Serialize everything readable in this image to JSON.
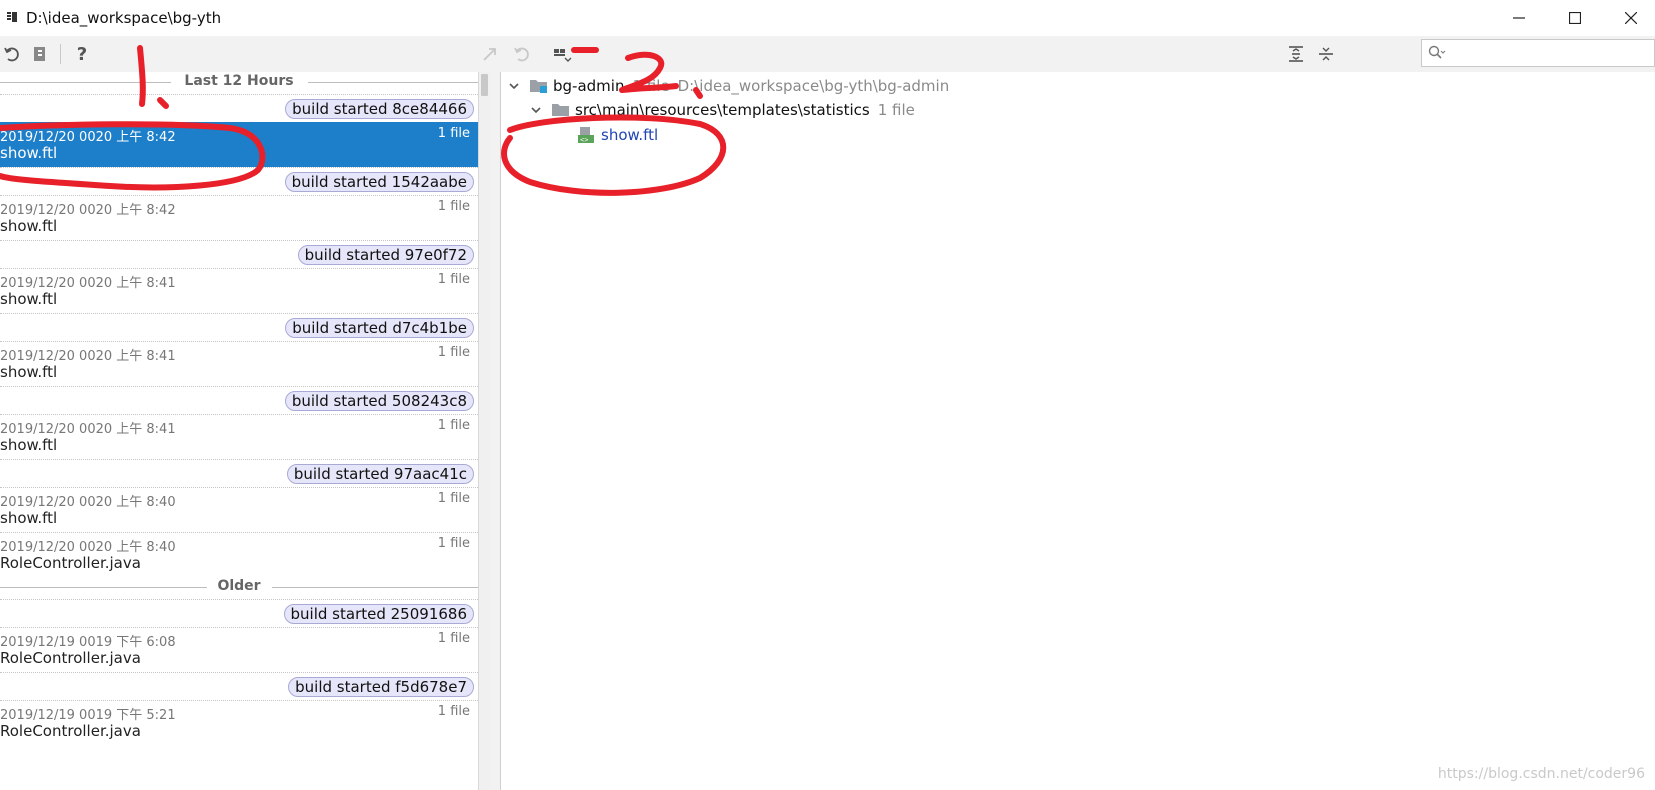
{
  "window": {
    "title": "D:\\idea_workspace\\bg-yth"
  },
  "left_toolbar": {
    "buttons": [
      "revert-icon",
      "patch-icon",
      "help-icon"
    ],
    "help_label": "?"
  },
  "right_toolbar": {
    "search": {
      "value": "",
      "placeholder": ""
    }
  },
  "history": {
    "sections": {
      "recent": "Last 12 Hours",
      "older": "Older"
    },
    "entries": [
      {
        "kind": "build",
        "label": "build started 8ce84466"
      },
      {
        "kind": "revision",
        "date": "2019/12/20 0020 上午 8:42",
        "file": "show.ftl",
        "count": "1 file",
        "selected": true
      },
      {
        "kind": "build",
        "label": "build started 1542aabe"
      },
      {
        "kind": "revision",
        "date": "2019/12/20 0020 上午 8:42",
        "file": "show.ftl",
        "count": "1 file"
      },
      {
        "kind": "build",
        "label": "build started 97e0f72"
      },
      {
        "kind": "revision",
        "date": "2019/12/20 0020 上午 8:41",
        "file": "show.ftl",
        "count": "1 file"
      },
      {
        "kind": "build",
        "label": "build started d7c4b1be"
      },
      {
        "kind": "revision",
        "date": "2019/12/20 0020 上午 8:41",
        "file": "show.ftl",
        "count": "1 file"
      },
      {
        "kind": "build",
        "label": "build started 508243c8"
      },
      {
        "kind": "revision",
        "date": "2019/12/20 0020 上午 8:41",
        "file": "show.ftl",
        "count": "1 file"
      },
      {
        "kind": "build",
        "label": "build started 97aac41c"
      },
      {
        "kind": "revision",
        "date": "2019/12/20 0020 上午 8:40",
        "file": "show.ftl",
        "count": "1 file"
      },
      {
        "kind": "revision",
        "date": "2019/12/20 0020 上午 8:40",
        "file": "RoleController.java",
        "count": "1 file"
      },
      {
        "kind": "build",
        "label": "build started 25091686"
      },
      {
        "kind": "revision",
        "date": "2019/12/19 0019 下午 6:08",
        "file": "RoleController.java",
        "count": "1 file"
      },
      {
        "kind": "build",
        "label": "build started f5d678e7"
      },
      {
        "kind": "revision",
        "date": "2019/12/19 0019 下午 5:21",
        "file": "RoleController.java",
        "count": "1 file"
      }
    ]
  },
  "tree": {
    "module": {
      "name": "bg-admin",
      "count": "1 file",
      "path": "D:\\idea_workspace\\bg-yth\\bg-admin"
    },
    "directory": {
      "name": "src\\main\\resources\\templates\\statistics",
      "count": "1 file"
    },
    "file": {
      "name": "show.ftl"
    }
  },
  "annotations": {
    "mark1": "1.",
    "mark2": "2."
  },
  "watermark": "https://blog.csdn.net/coder96",
  "colors": {
    "selection": "#1d7ec9",
    "badge_bg": "#e6e6fa",
    "badge_border": "#a9a9d6",
    "file_link": "#1f45b4",
    "annotation_red": "#e8202a"
  }
}
